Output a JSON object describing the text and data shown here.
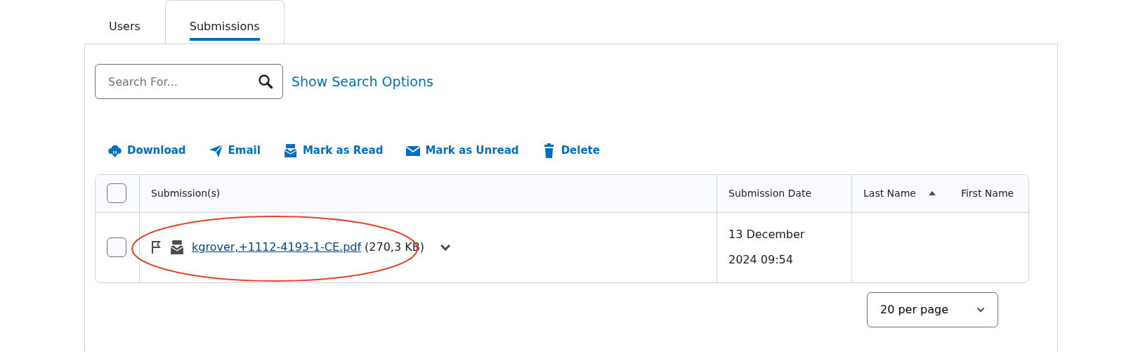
{
  "tabs": [
    {
      "label": "Users",
      "selected": false
    },
    {
      "label": "Submissions",
      "selected": true
    }
  ],
  "search": {
    "placeholder": "Search For...",
    "options_link": "Show Search Options"
  },
  "toolbar": [
    {
      "label": "Download",
      "kind": "download"
    },
    {
      "label": "Email",
      "kind": "send"
    },
    {
      "label": "Mark as Read",
      "kind": "read"
    },
    {
      "label": "Mark as Unread",
      "kind": "unread"
    },
    {
      "label": "Delete",
      "kind": "delete"
    }
  ],
  "table": {
    "select_all": {
      "checked": false
    },
    "columns": [
      {
        "label": "Submission(s)"
      },
      {
        "label": "Submission Date"
      },
      {
        "label": "Last Name",
        "sorted": true
      },
      {
        "label": "First Name"
      }
    ],
    "rows": [
      {
        "checked": false,
        "file": "kgrover,+1112-4193-1-CE.pdf",
        "size": "(270,3 KB)",
        "date": "13 December 2024 09:54",
        "highlighted": true
      }
    ]
  },
  "per_page": "20 per page"
}
